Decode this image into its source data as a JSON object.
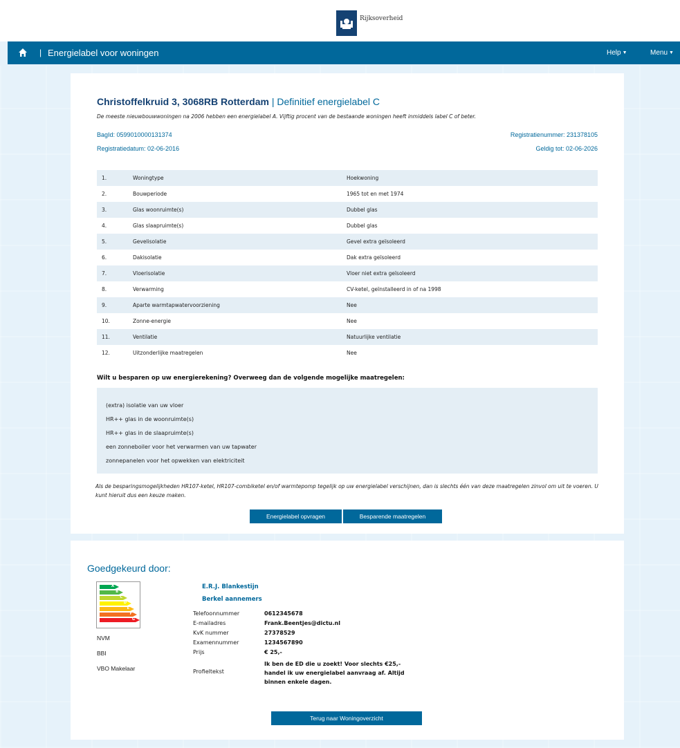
{
  "header": {
    "logo_text": "Rijksoverheid",
    "title": "Energielabel voor woningen",
    "separator": "|",
    "menu_help": "Help",
    "menu_main": "Menu"
  },
  "address": {
    "street": "Christoffelkruid 3, 3068RB Rotterdam",
    "separator": " | ",
    "label_status": "Definitief energielabel C",
    "subtitle": "De meeste nieuwbouwwoningen na 2006 hebben een energielabel A. Vijftig procent van de bestaande woningen heeft inmiddels label C of beter.",
    "bagid": "BagId: 0599010000131374",
    "registration_number": "Registratienummer: 231378105",
    "registration_date": "Registratiedatum: 02-06-2016",
    "valid_until": "Geldig tot: 02-06-2026"
  },
  "features": [
    {
      "num": "1.",
      "name": "Woningtype",
      "value": "Hoekwoning"
    },
    {
      "num": "2.",
      "name": "Bouwperiode",
      "value": "1965 tot en met 1974"
    },
    {
      "num": "3.",
      "name": "Glas woonruimte(s)",
      "value": "Dubbel glas"
    },
    {
      "num": "4.",
      "name": "Glas slaapruimte(s)",
      "value": "Dubbel glas"
    },
    {
      "num": "5.",
      "name": "Gevelisolatie",
      "value": "Gevel extra geïsoleerd"
    },
    {
      "num": "6.",
      "name": "Dakisolatie",
      "value": "Dak extra geïsoleerd"
    },
    {
      "num": "7.",
      "name": "Vloerisolatie",
      "value": "Vloer niet extra geïsoleerd"
    },
    {
      "num": "8.",
      "name": "Verwarming",
      "value": "CV-ketel, geïnstalleerd in of na 1998"
    },
    {
      "num": "9.",
      "name": "Aparte warmtapwatervoorziening",
      "value": "Nee"
    },
    {
      "num": "10.",
      "name": "Zonne-energie",
      "value": "Nee"
    },
    {
      "num": "11.",
      "name": "Ventilatie",
      "value": "Natuurlijke ventilatie"
    },
    {
      "num": "12.",
      "name": "Uitzonderlijke maatregelen",
      "value": "Nee"
    }
  ],
  "advice": {
    "question": "Wilt u besparen op uw energierekening? Overweeg dan de volgende mogelijke maatregelen:",
    "items": [
      "(extra) isolatie van uw vloer",
      "HR++ glas in de woonruimte(s)",
      "HR++ glas in de slaapruimte(s)",
      "een zonneboiler voor het verwarmen van uw tapwater",
      "zonnepanelen voor het opwekken van elektriciteit"
    ],
    "footnote": "Als de besparingsmogelijkheden HR107-ketel, HR107-combiketel en/of warmtepomp tegelijk op uw energielabel verschijnen, dan is slechts één van deze maatregelen zinvol om uit te voeren. U kunt hieruit dus een keuze maken."
  },
  "buttons": {
    "request_label": "Energielabel opvragen",
    "saving_measures": "Besparende maatregelen",
    "back": "Terug naar Woningoverzicht"
  },
  "approved": {
    "title": "Goedgekeurd door:",
    "energy_classes": [
      "A",
      "B",
      "C",
      "D",
      "E",
      "F",
      "G"
    ],
    "energy_colors": [
      "#00a651",
      "#52b848",
      "#bfd730",
      "#fff200",
      "#fdb913",
      "#f37021",
      "#ed1c24"
    ],
    "organisations": [
      "NVM",
      "BBI",
      "VBO Makelaar"
    ],
    "advisor_name": "E.R.J. Blankestijn",
    "advisor_company": "Berkel aannemers",
    "labels": {
      "phone": "Telefoonnummer",
      "email": "E-mailadres",
      "kvk": "KvK nummer",
      "exam": "Examennummer",
      "price": "Prijs",
      "profile": "Profieltekst"
    },
    "values": {
      "phone": "0612345678",
      "email": "Frank.Beentjes@dictu.nl",
      "kvk": "27378529",
      "exam": "1234567890",
      "price": "€ 25,-",
      "profile": "Ik ben de ED die u zoekt! Voor slechts €25,- handel ik uw energielabel aanvraag af. Altijd binnen enkele dagen."
    }
  }
}
